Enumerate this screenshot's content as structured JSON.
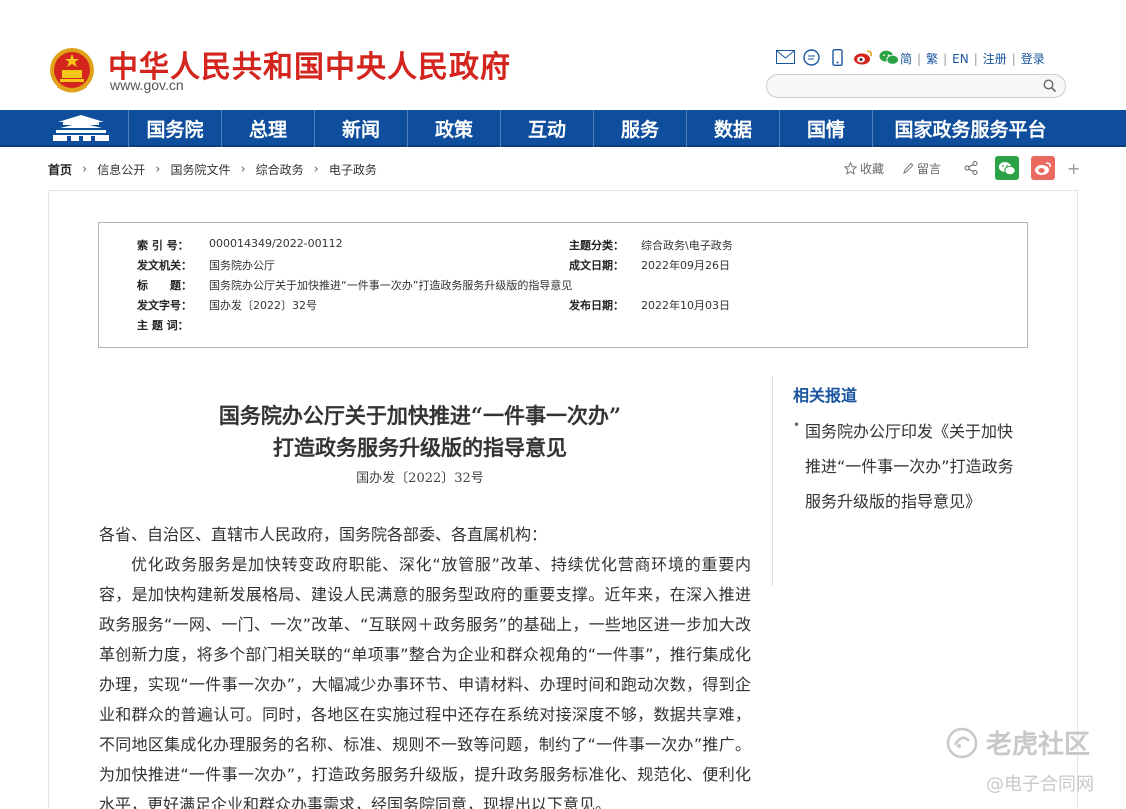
{
  "header": {
    "site_name": "中华人民共和国中央人民政府",
    "site_url": "www.gov.cn",
    "links": [
      "简",
      "繁",
      "EN",
      "注册",
      "登录"
    ],
    "search_placeholder": ""
  },
  "nav": {
    "items": [
      "国务院",
      "总理",
      "新闻",
      "政策",
      "互动",
      "服务",
      "数据",
      "国情",
      "国家政务服务平台"
    ]
  },
  "breadcrumb": [
    "首页",
    "信息公开",
    "国务院文件",
    "综合政务",
    "电子政务"
  ],
  "actions": {
    "favorite": "收藏",
    "comment": "留言"
  },
  "meta": {
    "index_label": "索 引 号：",
    "index_value": "000014349/2022-00112",
    "category_label": "主题分类：",
    "category_value": "综合政务\\电子政务",
    "issuer_label": "发文机关：",
    "issuer_value": "国务院办公厅",
    "written_label": "成文日期：",
    "written_value": "2022年09月26日",
    "title_label": "标　　题：",
    "title_value": "国务院办公厅关于加快推进“一件事一次办”打造政务服务升级版的指导意见",
    "docno_label": "发文字号：",
    "docno_value": "国办发〔2022〕32号",
    "published_label": "发布日期：",
    "published_value": "2022年10月03日",
    "keywords_label": "主 题 词："
  },
  "article": {
    "title_line1": "国务院办公厅关于加快推进“一件事一次办”",
    "title_line2": "打造政务服务升级版的指导意见",
    "doc_number": "国办发〔2022〕32号",
    "salutation": "各省、自治区、直辖市人民政府，国务院各部委、各直属机构：",
    "paragraph1": "优化政务服务是加快转变政府职能、深化“放管服”改革、持续优化营商环境的重要内容，是加快构建新发展格局、建设人民满意的服务型政府的重要支撑。近年来，在深入推进政务服务“一网、一门、一次”改革、“互联网＋政务服务”的基础上，一些地区进一步加大改革创新力度，将多个部门相关联的“单项事”整合为企业和群众视角的“一件事”，推行集成化办理，实现“一件事一次办”，大幅减少办事环节、申请材料、办理时间和跑动次数，得到企业和群众的普遍认可。同时，各地区在实施过程中还存在系统对接深度不够，数据共享难，不同地区集成化办理服务的名称、标准、规则不一致等问题，制约了“一件事一次办”推广。为加快推进“一件事一次办”，打造政务服务升级版，提升政务服务标准化、规范化、便利化水平，更好满足企业和群众办事需求，经国务院同意，现提出以下意见。"
  },
  "sidebar": {
    "title": "相关报道",
    "items": [
      "国务院办公厅印发《关于加快推进“一件事一次办”打造政务服务升级版的指导意见》"
    ]
  },
  "watermark": {
    "line1": "老虎社区",
    "line2": "@电子合同网"
  },
  "colors": {
    "brand_red": "#d3251e",
    "nav_blue": "#0e4e9c",
    "link_blue": "#1a56a0"
  }
}
